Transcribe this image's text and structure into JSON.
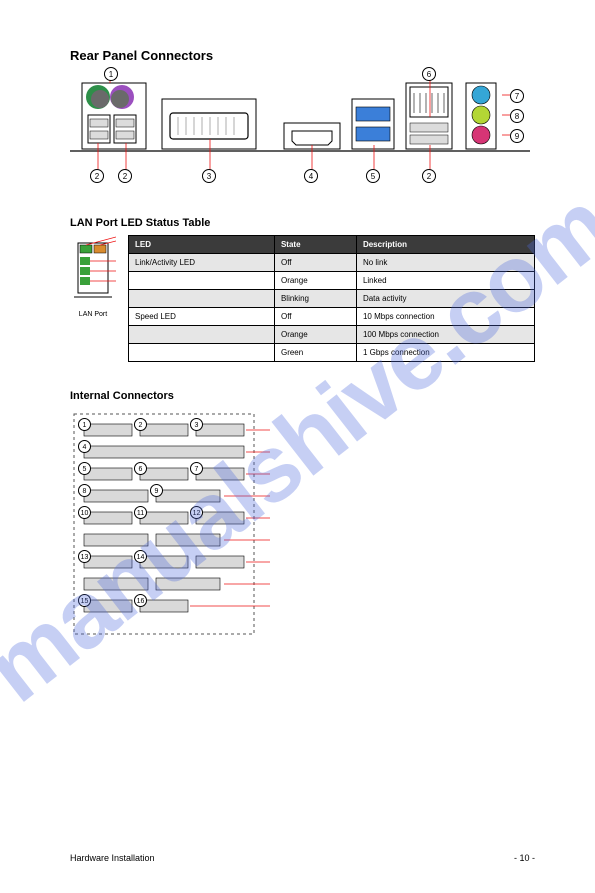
{
  "section_title": "Rear Panel Connectors",
  "intro_text": "",
  "rear_callouts": [
    "1",
    "2",
    "2",
    "3",
    "4",
    "5",
    "6",
    "7",
    "8",
    "9"
  ],
  "lan_caption": "LAN Port LED Status Table",
  "lan_mini_labels": {
    "left": "Link/Activity LED",
    "right": "Speed LED",
    "port": "LAN Port"
  },
  "lan_table": {
    "headers": [
      "LED",
      "State",
      "Description"
    ],
    "rows": [
      [
        "Link/Activity LED",
        "Off",
        "No link"
      ],
      [
        "",
        "Orange",
        "Linked"
      ],
      [
        "",
        "Blinking",
        "Data activity"
      ],
      [
        "Speed LED",
        "Off",
        "10 Mbps connection"
      ],
      [
        "",
        "Orange",
        "100 Mbps connection"
      ],
      [
        "",
        "Green",
        "1 Gbps connection"
      ]
    ]
  },
  "internal_title": "Internal Connectors",
  "internal_text": "",
  "internal_callouts": [
    "1",
    "2",
    "3",
    "4",
    "5",
    "6",
    "7",
    "8",
    "9",
    "10",
    "11",
    "12",
    "13",
    "14",
    "15",
    "16"
  ],
  "footer_left": "Hardware Installation",
  "footer_right": "- 10 -"
}
